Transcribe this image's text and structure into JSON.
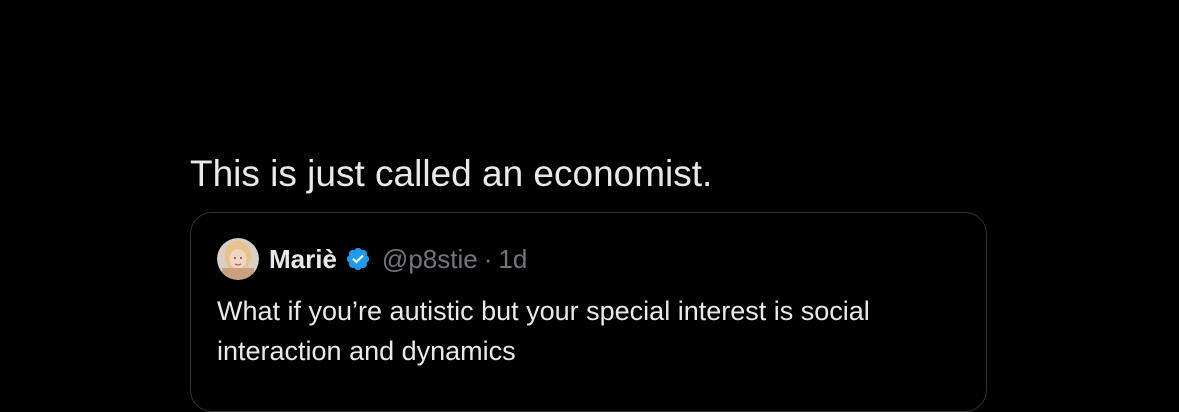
{
  "post": {
    "text": "This is just called an economist."
  },
  "quoted_post": {
    "display_name": "Mariè",
    "verified": true,
    "handle": "@p8stie",
    "separator": "·",
    "time": "1d",
    "text": "What if you’re autistic but your special interest is social interaction and dynamics"
  },
  "colors": {
    "background": "#000000",
    "primary_text": "#e7e9ea",
    "secondary_text": "#71767b",
    "border": "#2f3336",
    "verified_badge": "#1d9bf0"
  },
  "icons": {
    "verified": "verified-badge-icon",
    "avatar": "profile-photo"
  }
}
